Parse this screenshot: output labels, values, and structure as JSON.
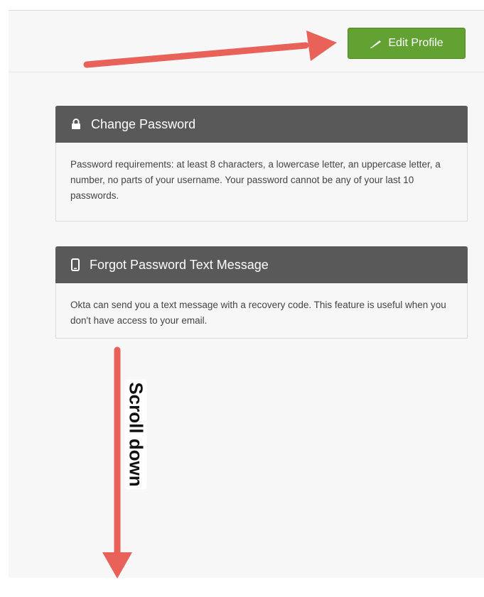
{
  "header": {
    "edit_profile_label": "Edit Profile",
    "edit_profile_icon": "pencil-icon",
    "button_color": "#62a233"
  },
  "cards": [
    {
      "title": "Change Password",
      "icon": "lock-icon",
      "body": "Password requirements: at least 8 characters, a lowercase letter, an uppercase letter, a number, no parts of your username. Your password cannot be any of your last 10 passwords."
    },
    {
      "title": "Forgot Password Text Message",
      "icon": "phone-icon",
      "body": "Okta can send you a text message with a recovery code. This feature is useful when you don't have access to your email."
    }
  ],
  "annotation": {
    "scroll_label": "Scroll down",
    "arrow_color": "#e8625a"
  }
}
